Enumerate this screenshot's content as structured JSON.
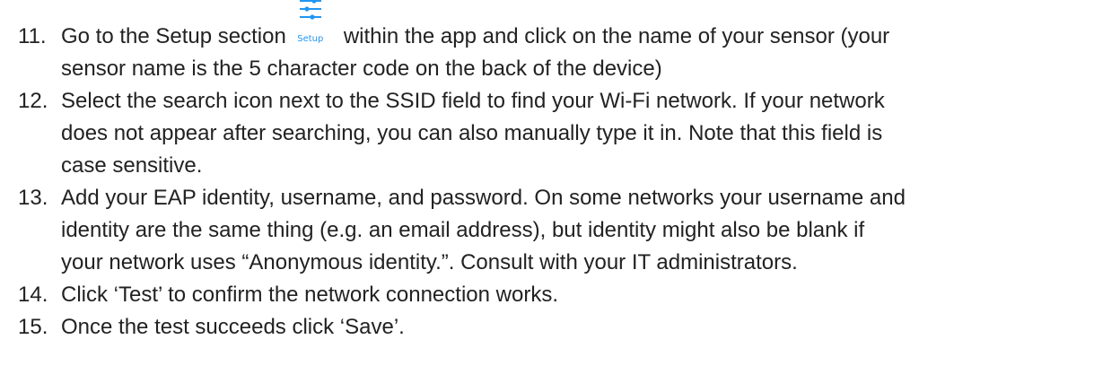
{
  "steps": [
    {
      "number": "11.",
      "lines": [
        "Go to the Setup section",
        "within the app and click on the name of your sensor (your",
        "sensor name is the 5 character code on the back of the device)"
      ],
      "inline_icon": {
        "name": "tune-sliders-icon",
        "caption": "Setup",
        "color": "#2196f3"
      }
    },
    {
      "number": "12.",
      "lines": [
        "Select the search icon next to the SSID field to find your Wi-Fi network. If your network",
        "does not appear after searching, you can also manually type it in. Note that this field is",
        "case sensitive."
      ]
    },
    {
      "number": "13.",
      "lines": [
        "Add your EAP identity, username, and password. On some networks your username and",
        "identity are the same thing (e.g. an email address), but identity might also be blank if",
        "your network uses “Anonymous identity.”. Consult with your IT administrators."
      ]
    },
    {
      "number": "14.",
      "lines": [
        "Click ‘Test’ to confirm the network connection works."
      ]
    },
    {
      "number": "15.",
      "lines": [
        "Once the test succeeds click ‘Save’."
      ]
    }
  ]
}
